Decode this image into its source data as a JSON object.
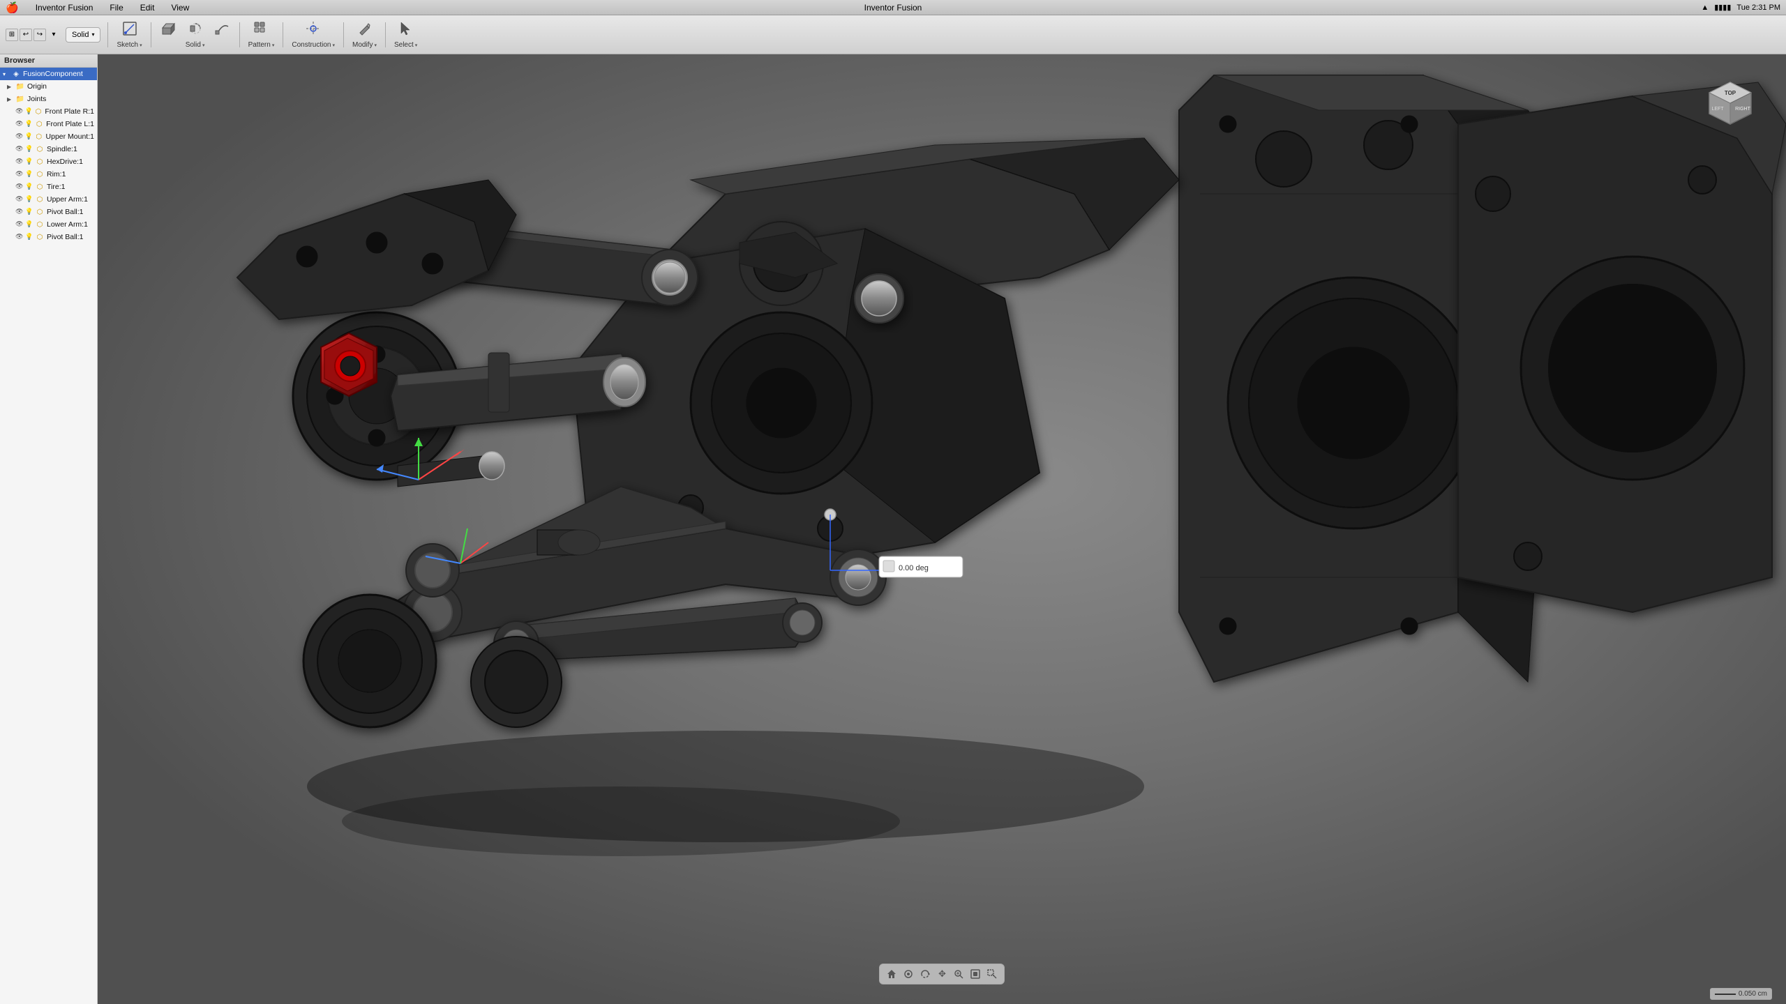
{
  "app": {
    "name": "Inventor Fusion",
    "title": "Inventor Fusion",
    "time": "Tue 2:31 PM"
  },
  "menubar": {
    "apple": "🍎",
    "items": [
      {
        "label": "Inventor Fusion",
        "id": "app-menu"
      },
      {
        "label": "File",
        "id": "file-menu"
      },
      {
        "label": "Edit",
        "id": "edit-menu"
      },
      {
        "label": "View",
        "id": "view-menu"
      }
    ],
    "right_icons": [
      "wifi",
      "battery",
      "clock"
    ]
  },
  "toolbar": {
    "solid_label": "Solid",
    "groups": [
      {
        "id": "sketch",
        "label": "Sketch",
        "has_arrow": true,
        "icons": [
          "sketch-icon"
        ]
      },
      {
        "id": "solid",
        "label": "Solid",
        "has_arrow": true,
        "icons": [
          "solid-icon1",
          "solid-icon2",
          "solid-icon3"
        ]
      },
      {
        "id": "pattern",
        "label": "Pattern",
        "has_arrow": true,
        "icons": [
          "pattern-icon"
        ]
      },
      {
        "id": "construction",
        "label": "Construction",
        "has_arrow": true,
        "icons": [
          "construction-icon"
        ]
      },
      {
        "id": "modify",
        "label": "Modify",
        "has_arrow": true,
        "icons": [
          "modify-icon"
        ]
      },
      {
        "id": "select",
        "label": "Select",
        "has_arrow": true,
        "icons": [
          "select-icon"
        ]
      }
    ]
  },
  "browser": {
    "header": "Browser",
    "items": [
      {
        "id": "fusion-component",
        "label": "FusionComponent",
        "level": 0,
        "expanded": true,
        "selected": true,
        "type": "component"
      },
      {
        "id": "origin",
        "label": "Origin",
        "level": 1,
        "expanded": false,
        "type": "folder"
      },
      {
        "id": "joints",
        "label": "Joints",
        "level": 1,
        "expanded": false,
        "type": "folder"
      },
      {
        "id": "front-plate-r1",
        "label": "Front Plate R:1",
        "level": 1,
        "expanded": false,
        "type": "body",
        "visible": true
      },
      {
        "id": "front-plate-l1",
        "label": "Front Plate L:1",
        "level": 1,
        "expanded": false,
        "type": "body",
        "visible": true
      },
      {
        "id": "upper-mount-1",
        "label": "Upper Mount:1",
        "level": 1,
        "expanded": false,
        "type": "body",
        "visible": true
      },
      {
        "id": "spindle-1",
        "label": "Spindle:1",
        "level": 1,
        "expanded": false,
        "type": "body",
        "visible": true
      },
      {
        "id": "hexdrive-1",
        "label": "HexDrive:1",
        "level": 1,
        "expanded": false,
        "type": "body",
        "visible": true
      },
      {
        "id": "rim-1",
        "label": "Rim:1",
        "level": 1,
        "expanded": false,
        "type": "body",
        "visible": true
      },
      {
        "id": "tire-1",
        "label": "Tire:1",
        "level": 1,
        "expanded": false,
        "type": "body",
        "visible": true
      },
      {
        "id": "upper-arm-1",
        "label": "Upper Arm:1",
        "level": 1,
        "expanded": false,
        "type": "body",
        "visible": true
      },
      {
        "id": "pivot-ball-1a",
        "label": "Pivot Ball:1",
        "level": 1,
        "expanded": false,
        "type": "body",
        "visible": true
      },
      {
        "id": "lower-arm-1",
        "label": "Lower Arm:1",
        "level": 1,
        "expanded": false,
        "type": "body",
        "visible": true
      },
      {
        "id": "pivot-ball-1b",
        "label": "Pivot Ball:1",
        "level": 1,
        "expanded": false,
        "type": "body",
        "visible": true
      }
    ]
  },
  "viewport": {
    "background_color": "#757575"
  },
  "nav_toolbar": {
    "buttons": [
      {
        "id": "nav-home",
        "icon": "⌂",
        "label": "Home"
      },
      {
        "id": "nav-look",
        "icon": "◉",
        "label": "Look"
      },
      {
        "id": "nav-orbit",
        "icon": "↺",
        "label": "Orbit"
      },
      {
        "id": "nav-pan",
        "icon": "✥",
        "label": "Pan"
      },
      {
        "id": "nav-zoom",
        "icon": "⊕",
        "label": "Zoom"
      },
      {
        "id": "nav-fit",
        "icon": "⊡",
        "label": "Fit"
      },
      {
        "id": "nav-zoombox",
        "icon": "⊞",
        "label": "Zoom Box"
      }
    ]
  },
  "dimension_input": {
    "value": "0.00 deg",
    "icon": "dim-icon"
  },
  "viewcube": {
    "label": "Right ,"
  },
  "statusbar": {
    "scale": "0.050 cm"
  }
}
